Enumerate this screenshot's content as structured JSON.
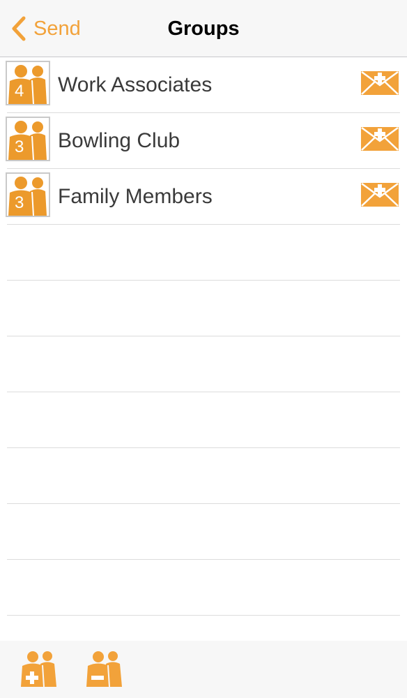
{
  "navbar": {
    "back_label": "Send",
    "title": "Groups"
  },
  "groups": [
    {
      "name": "Work Associates",
      "count": "4"
    },
    {
      "name": "Bowling Club",
      "count": "3"
    },
    {
      "name": "Family Members",
      "count": "3"
    }
  ],
  "icons": {
    "back": "chevron-left-icon",
    "group": "group-people-icon",
    "mail": "mail-plus-icon",
    "add_group": "add-group-icon",
    "remove_group": "remove-group-icon"
  },
  "colors": {
    "accent": "#f2a23a",
    "navbar_bg": "#f7f7f7",
    "divider": "#dcdcdc"
  }
}
